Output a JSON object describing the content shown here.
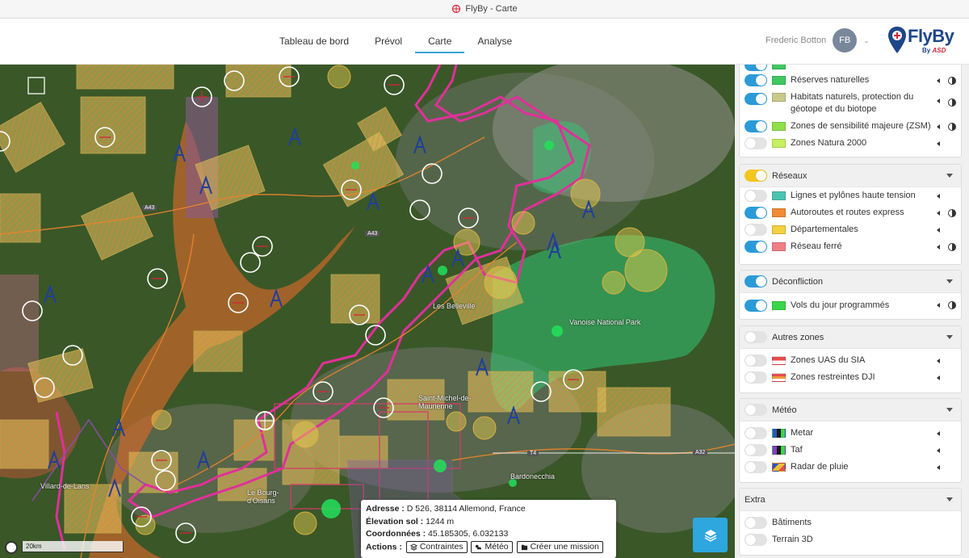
{
  "window": {
    "title": "FlyBy - Carte"
  },
  "nav": {
    "items": [
      "Tableau de bord",
      "Prévol",
      "Carte",
      "Analyse"
    ],
    "active": "Carte"
  },
  "user": {
    "name": "Frederic Botton",
    "initials": "FB"
  },
  "logo": {
    "name": "FlyBy",
    "sub_by": "By",
    "sub_brand": "ASD"
  },
  "map": {
    "labels": [
      {
        "text": "Les Belleville"
      },
      {
        "text": "Vanoise National Park"
      },
      {
        "text": "Saint-Michel-de-Maurienne"
      },
      {
        "text": "Bardonecchia"
      },
      {
        "text": "Villard-de-Lans"
      },
      {
        "text": "Le Bourg-d'Oisans"
      }
    ],
    "road_badges": [
      "A43",
      "A43",
      "A32",
      "T4"
    ],
    "scale": "20km"
  },
  "popup": {
    "address_label": "Adresse :",
    "address": "D 526, 38114 Allemond, France",
    "elevation_label": "Élevation sol :",
    "elevation": "1244 m",
    "coords_label": "Coordonnées :",
    "coords": "45.185305, 6.032133",
    "actions_label": "Actions :",
    "actions": [
      "Contraintes",
      "Météo",
      "Créer une mission"
    ]
  },
  "panel": {
    "environment": {
      "items": [
        {
          "label": "Réserves naturelles",
          "on": true,
          "color": "#3fc860"
        },
        {
          "label": "Habitats naturels, protection du géotope et du biotope",
          "on": true,
          "color": "#c9c98a"
        },
        {
          "label": "Zones de sensibilité majeure (ZSM)",
          "on": true,
          "color": "#8fe04b"
        },
        {
          "label": "Zones Natura 2000",
          "on": false,
          "color": "#c5f060"
        }
      ]
    },
    "reseaux": {
      "title": "Réseaux",
      "items": [
        {
          "label": "Lignes et pylônes haute tension",
          "on": false,
          "color": "#4cc3b0"
        },
        {
          "label": "Autoroutes et routes express",
          "on": true,
          "color": "#f08a34"
        },
        {
          "label": "Départementales",
          "on": false,
          "color": "#f5d040"
        },
        {
          "label": "Réseau ferré",
          "on": true,
          "color": "#f07f85"
        }
      ]
    },
    "deconfliction": {
      "title": "Déconfliction",
      "items": [
        {
          "label": "Vols du jour programmés",
          "on": true,
          "color": "#3ad64a"
        }
      ]
    },
    "autres": {
      "title": "Autres zones",
      "items": [
        {
          "label": "Zones UAS du SIA",
          "on": false,
          "color": "#e84a4a"
        },
        {
          "label": "Zones restreintes DJI",
          "on": false,
          "color": "#f09a3a"
        }
      ]
    },
    "meteo": {
      "title": "Météo",
      "items": [
        {
          "label": "Metar",
          "on": false
        },
        {
          "label": "Taf",
          "on": false
        },
        {
          "label": "Radar de pluie",
          "on": false
        }
      ]
    },
    "extra": {
      "title": "Extra",
      "items": [
        {
          "label": "Bâtiments",
          "on": false
        },
        {
          "label": "Terrain 3D",
          "on": false
        }
      ]
    }
  }
}
